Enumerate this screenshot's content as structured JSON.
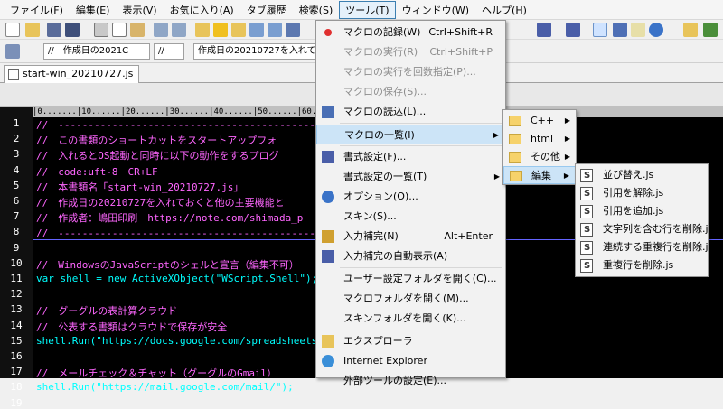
{
  "menubar": [
    "ファイル(F)",
    "編集(E)",
    "表示(V)",
    "お気に入り(A)",
    "タブ履歴",
    "検索(S)",
    "ツール(T)",
    "ウィンドウ(W)",
    "ヘルプ(H)"
  ],
  "toolbar2": {
    "combo1": "//　作成日の2021C",
    "combo2": "//",
    "combo3": "作成日の20210727を入れてお"
  },
  "tab": {
    "filename": "start-win_20210727.js"
  },
  "ruler": "|0.......|10......|20......|30......|40......|50......|60......|70......|80......|90......|100",
  "lines": [
    {
      "n": "1",
      "t": "//　-----------------------------------------------"
    },
    {
      "n": "2",
      "t": "//　この書類のショートカットをスタートアップフォ"
    },
    {
      "n": "3",
      "t": "//　入れるとOS起動と同時に以下の動作をするプログ"
    },
    {
      "n": "4",
      "t": "//　code:uft-8　CR+LF"
    },
    {
      "n": "5",
      "t": "//　本書類名「start-win_20210727.js」"
    },
    {
      "n": "6",
      "t": "//　作成日の20210727を入れておくと他の主要機能と"
    },
    {
      "n": "7",
      "t": "//　作成者：嶋田印刷　https://note.com/shimada_p"
    },
    {
      "n": "8",
      "t": "//　-----------------------------------------------"
    },
    {
      "n": "9",
      "t": ""
    },
    {
      "n": "10",
      "t": "//　WindowsのJavaScriptのシェルと宣言（編集不可）"
    },
    {
      "n": "11",
      "t": "var shell = new ActiveXObject(\"WScript.Shell\");"
    },
    {
      "n": "12",
      "t": ""
    },
    {
      "n": "13",
      "t": "//　グーグルの表計算クラウド"
    },
    {
      "n": "14",
      "t": "//　公表する書類はクラウドで保存が安全"
    },
    {
      "n": "15",
      "t": "shell.Run(\"https://docs.google.com/spreadsheets/"
    },
    {
      "n": "16",
      "t": ""
    },
    {
      "n": "17",
      "t": "//　メールチェック＆チャット（グーグルのGmail）"
    },
    {
      "n": "18",
      "t": "shell.Run(\"https://mail.google.com/mail/\");"
    },
    {
      "n": "19",
      "t": ""
    }
  ],
  "tools_menu": [
    {
      "label": "マクロの記録(W)",
      "shortcut": "Ctrl+Shift+R",
      "disabled": false,
      "icon": "record-icon"
    },
    {
      "label": "マクロの実行(R)",
      "shortcut": "Ctrl+Shift+P",
      "disabled": true,
      "icon": ""
    },
    {
      "label": "マクロの実行を回数指定(P)...",
      "shortcut": "",
      "disabled": true,
      "icon": ""
    },
    {
      "label": "マクロの保存(S)...",
      "shortcut": "",
      "disabled": true,
      "icon": ""
    },
    {
      "label": "マクロの読込(L)...",
      "shortcut": "",
      "disabled": false,
      "icon": "load-icon"
    },
    {
      "label": "マクロの一覧(I)",
      "shortcut": "",
      "disabled": false,
      "icon": "",
      "submenu": true,
      "highlighted": true
    },
    {
      "label": "書式設定(F)...",
      "shortcut": "",
      "disabled": false,
      "icon": "format-icon"
    },
    {
      "label": "書式設定の一覧(T)",
      "shortcut": "",
      "disabled": false,
      "icon": "",
      "submenu": true
    },
    {
      "label": "オプション(O)...",
      "shortcut": "",
      "disabled": false,
      "icon": "options-icon"
    },
    {
      "label": "スキン(S)...",
      "shortcut": "",
      "disabled": false,
      "icon": ""
    },
    {
      "label": "入力補完(N)",
      "shortcut": "Alt+Enter",
      "disabled": false,
      "icon": "completion-icon"
    },
    {
      "label": "入力補完の自動表示(A)",
      "shortcut": "",
      "disabled": false,
      "icon": "auto-completion-icon"
    },
    {
      "label": "ユーザー設定フォルダを開く(C)...",
      "shortcut": "",
      "disabled": false,
      "icon": ""
    },
    {
      "label": "マクロフォルダを開く(M)...",
      "shortcut": "",
      "disabled": false,
      "icon": ""
    },
    {
      "label": "スキンフォルダを開く(K)...",
      "shortcut": "",
      "disabled": false,
      "icon": ""
    },
    {
      "label": "エクスプローラ",
      "shortcut": "",
      "disabled": false,
      "icon": "explorer-icon"
    },
    {
      "label": "Internet Explorer",
      "shortcut": "",
      "disabled": false,
      "icon": "ie-icon"
    },
    {
      "label": "外部ツールの設定(E)...",
      "shortcut": "",
      "disabled": false,
      "icon": ""
    }
  ],
  "macro_submenu": [
    {
      "label": "C++"
    },
    {
      "label": "html"
    },
    {
      "label": "その他"
    },
    {
      "label": "編集",
      "highlighted": true
    }
  ],
  "edit_submenu": [
    "並び替え.js",
    "引用を解除.js",
    "引用を追加.js",
    "文字列を含む行を削除.js",
    "連続する重複行を削除.js",
    "重複行を削除.js"
  ],
  "colors": {
    "editor_bg": "#000000",
    "comment": "#ff66ff",
    "keyword": "#00ffff",
    "menu_highlight": "#cce4f7"
  }
}
